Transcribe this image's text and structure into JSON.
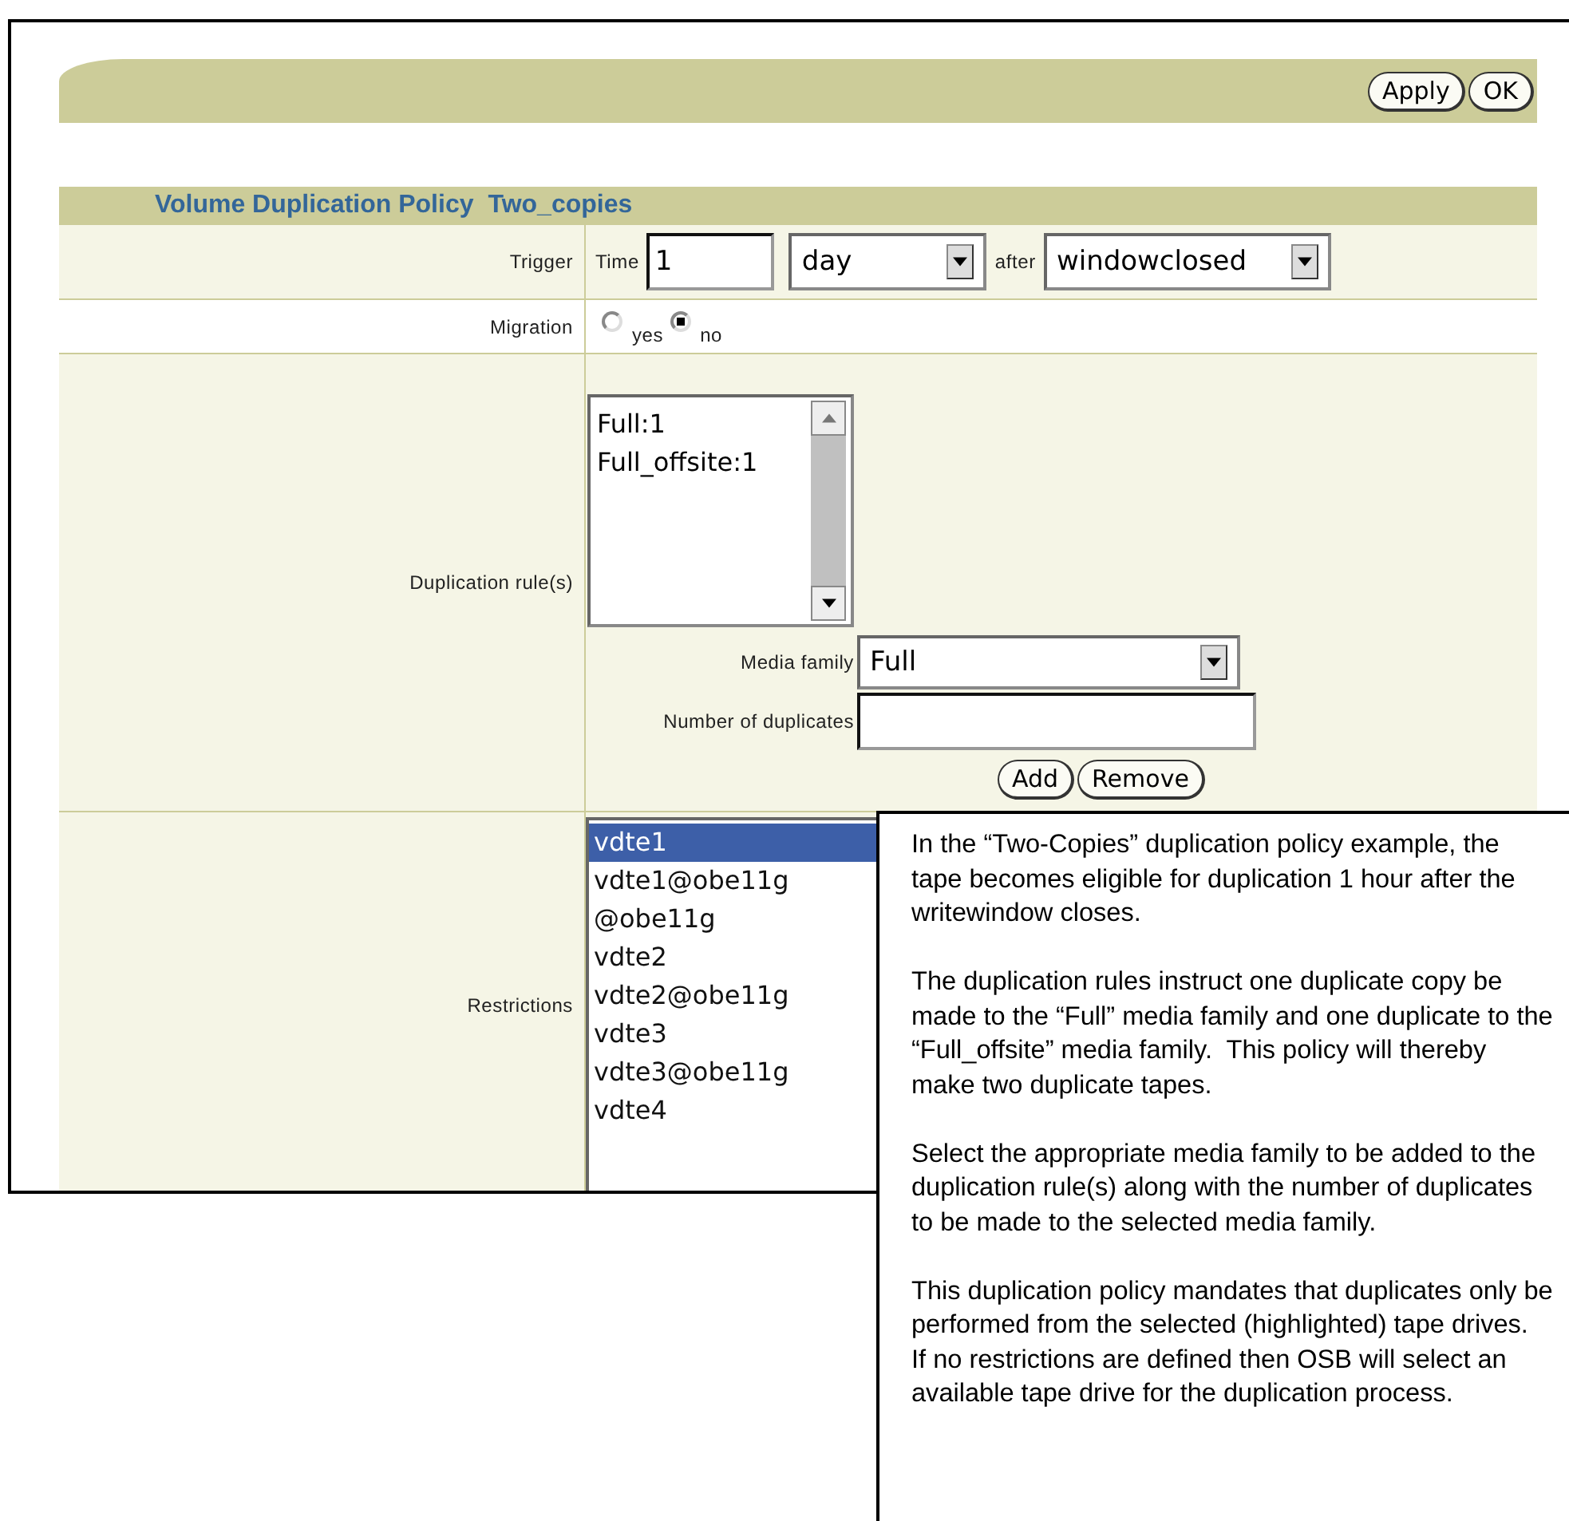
{
  "toolbar": {
    "buttons": [
      "Apply",
      "OK"
    ]
  },
  "form": {
    "title": "Volume Duplication Policy",
    "policy_name": "Two_copies",
    "trigger": {
      "label": "Trigger",
      "time_label": "Time",
      "time_value": "1",
      "unit": "day",
      "after_label": "after",
      "event": "windowclosed"
    },
    "migration": {
      "label": "Migration",
      "options": [
        {
          "label": "yes",
          "selected": false
        },
        {
          "label": "no",
          "selected": true
        }
      ]
    },
    "duplication_rules": {
      "label": "Duplication rule(s)",
      "items": [
        "Full:1",
        "Full_offsite:1"
      ],
      "media_family_label": "Media family",
      "media_family": "Full",
      "number_label": "Number of duplicates",
      "buttons": [
        "Add",
        "Remove"
      ]
    },
    "restrictions": {
      "label": "Restrictions",
      "items": [
        {
          "label": "vdte1",
          "selected": true
        },
        {
          "label": "vdte1@obe11g",
          "selected": false
        },
        {
          "label": "@obe11g",
          "selected": false
        },
        {
          "label": "vdte2",
          "selected": false
        },
        {
          "label": "vdte2@obe11g",
          "selected": false
        },
        {
          "label": "vdte3",
          "selected": false
        },
        {
          "label": "vdte3@obe11g",
          "selected": false
        },
        {
          "label": "vdte4",
          "selected": false
        }
      ]
    }
  },
  "callout": {
    "paragraphs": [
      "In the “Two-Copies” duplication policy example, the tape becomes eligible for duplication 1 hour after the writewindow closes.",
      "The duplication rules instruct one duplicate copy be made to the “Full” media family and one duplicate to the “Full_offsite” media family.  This policy will thereby make two duplicate tapes.",
      "Select the appropriate media family to be added to the duplication rule(s) along with the number of duplicates to be made to the selected media family.",
      "This duplication policy mandates that duplicates only be performed from the selected (highlighted) tape drives.  If no restrictions are defined then OSB will select an available tape drive for the duplication process."
    ]
  }
}
